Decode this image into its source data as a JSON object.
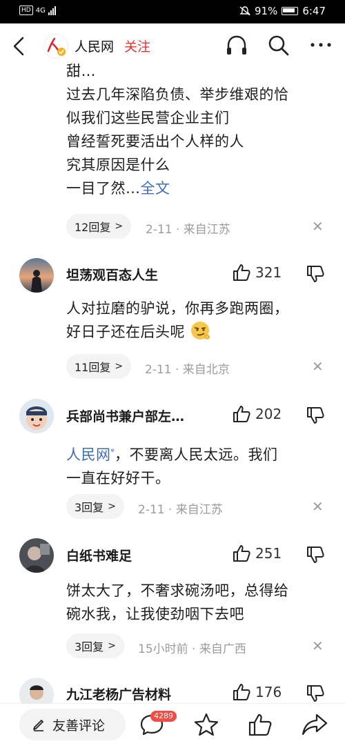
{
  "status_bar": {
    "hd_label": "HD",
    "network_label": "4G",
    "battery_text": "91%",
    "time": "6:47"
  },
  "header": {
    "account_name": "人民网",
    "follow_label": "关注",
    "icons": [
      "back-arrow-icon",
      "headphones-icon",
      "search-icon",
      "more-icon"
    ]
  },
  "first_comment": {
    "lines": [
      "甜…",
      "过去几年深陷负债、举步维艰的恰",
      "似我们这些民营企业主们",
      "曾经誓死要活出个人样的人",
      "究其原因是什么"
    ],
    "last_line": "一目了然…",
    "expand_label": "全文",
    "reply_label": "12回复",
    "meta": "2-11 · 来自江苏"
  },
  "comments": [
    {
      "name": "坦荡观百态人生",
      "likes": "321",
      "lines": [
        "人对拉磨的驴说，你再多跑两圈，",
        "好日子还在后头呢"
      ],
      "emoji": "smirk-emoji-icon",
      "reply_label": "11回复",
      "meta": "2-11 · 来自北京"
    },
    {
      "name": "兵部尚书兼户部左…",
      "likes": "202",
      "mention": "人民网",
      "lines": [
        "，不要离人民太远。我们",
        "一直在好好干。"
      ],
      "reply_label": "3回复",
      "meta": "2-11 · 来自江苏"
    },
    {
      "name": "白纸书难足",
      "likes": "251",
      "lines": [
        "饼太大了，不奢求碗汤吧，总得给",
        "碗水我，让我使劲咽下去吧"
      ],
      "reply_label": "3回复",
      "meta": "15小时前 · 来自广西"
    },
    {
      "name": "九江老杨广告材料",
      "likes": "176"
    }
  ],
  "bottom_bar": {
    "comment_placeholder": "友善评论",
    "comment_count": "4289"
  },
  "colors": {
    "accent_red": "#e5322d",
    "link_blue": "#3d6eb5",
    "meta_gray": "#9b9b9b"
  }
}
